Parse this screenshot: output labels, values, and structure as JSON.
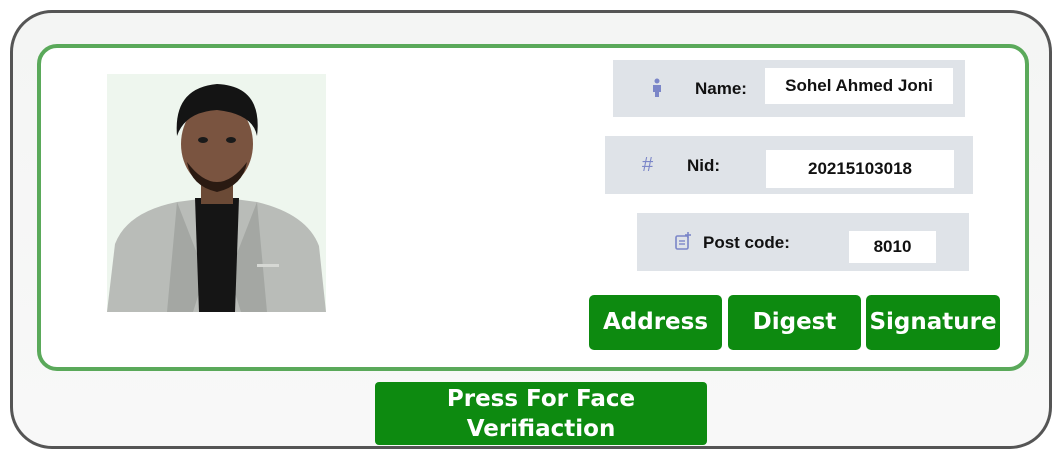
{
  "profile": {
    "name_label": "Name:",
    "name_value": "Sohel Ahmed Joni",
    "nid_label": "Nid:",
    "nid_value": "20215103018",
    "postcode_label": "Post code:",
    "postcode_value": "8010"
  },
  "icons": {
    "name": "person-icon",
    "nid": "hash-icon",
    "postcode": "note-icon"
  },
  "buttons": {
    "address": "Address",
    "digest": "Digest",
    "signature": "Signature",
    "face_verification_line1": "Press For Face",
    "face_verification_line2": "Verifiaction"
  },
  "colors": {
    "primary_green": "#0d8a10",
    "panel_border": "#5aa95a",
    "field_bg": "#dfe3e8",
    "icon": "#7b86c8"
  }
}
